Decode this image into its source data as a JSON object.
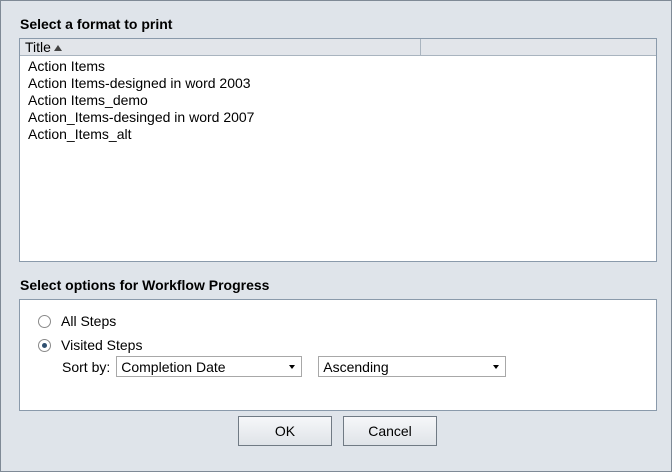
{
  "format_section": {
    "title": "Select a format to print",
    "column_header": "Title",
    "items": [
      "Action Items",
      "Action Items-designed in word 2003",
      "Action Items_demo",
      "Action_Items-desinged in word 2007",
      "Action_Items_alt"
    ]
  },
  "options_section": {
    "title": "Select options for Workflow Progress",
    "radio_all": "All Steps",
    "radio_visited": "Visited Steps",
    "sort_by_label": "Sort by:",
    "sort_field_value": "Completion Date",
    "sort_order_value": "Ascending"
  },
  "buttons": {
    "ok": "OK",
    "cancel": "Cancel"
  }
}
